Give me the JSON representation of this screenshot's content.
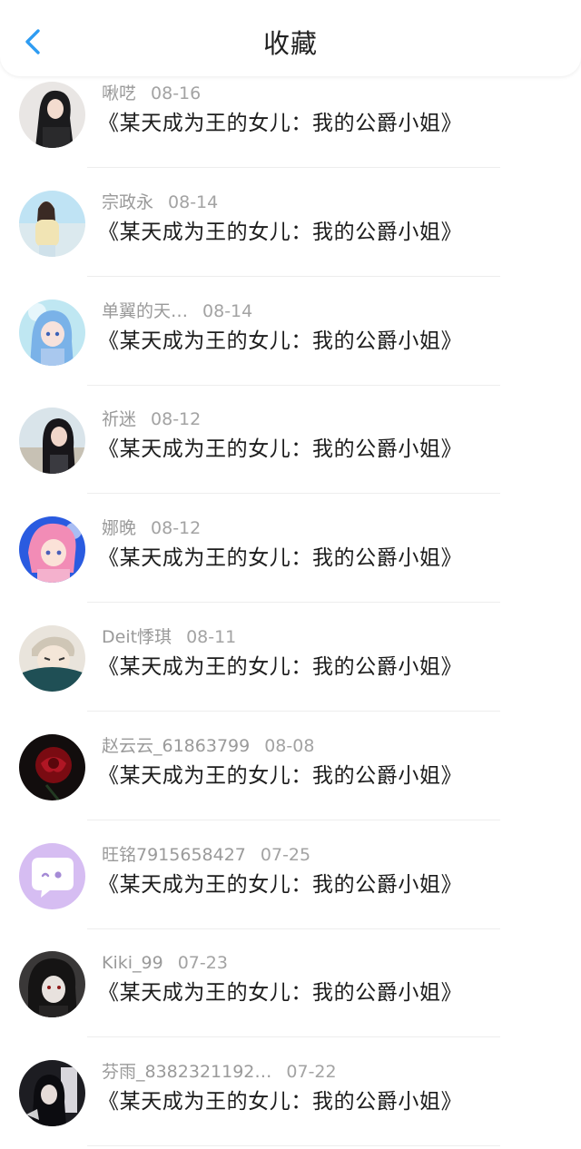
{
  "header": {
    "title": "收藏",
    "back_icon": "chevron-left-icon",
    "accent_color": "#2e9cf2"
  },
  "items": [
    {
      "user": "啾呓",
      "date": "08-16",
      "text": "《某天成为王的女儿：我的公爵小姐》",
      "avatar": "photo-girl-dark-hair"
    },
    {
      "user": "宗政永",
      "date": "08-14",
      "text": "《某天成为王的女儿：我的公爵小姐》",
      "avatar": "photo-girl-beach"
    },
    {
      "user": "单翼的天…",
      "date": "08-14",
      "text": "《某天成为王的女儿：我的公爵小姐》",
      "avatar": "anime-blue-hair"
    },
    {
      "user": "祈迷",
      "date": "08-12",
      "text": "《某天成为王的女儿：我的公爵小姐》",
      "avatar": "photo-girl-seaside"
    },
    {
      "user": "娜晚",
      "date": "08-12",
      "text": "《某天成为王的女儿：我的公爵小姐》",
      "avatar": "anime-pink-hair"
    },
    {
      "user": "Deit悸琪",
      "date": "08-11",
      "text": "《某天成为王的女儿：我的公爵小姐》",
      "avatar": "anime-scarf-boy"
    },
    {
      "user": "赵云云_61863799",
      "date": "08-08",
      "text": "《某天成为王的女儿：我的公爵小姐》",
      "avatar": "red-rose"
    },
    {
      "user": "旺铭7915658427",
      "date": "07-25",
      "text": "《某天成为王的女儿：我的公爵小姐》",
      "avatar": "chat-bubble-default"
    },
    {
      "user": "Kiki_99",
      "date": "07-23",
      "text": "《某天成为王的女儿：我的公爵小姐》",
      "avatar": "anime-dark-boy"
    },
    {
      "user": "芬雨_8382321192…",
      "date": "07-22",
      "text": "《某天成为王的女儿：我的公爵小姐》",
      "avatar": "photo-dark-portrait"
    }
  ]
}
